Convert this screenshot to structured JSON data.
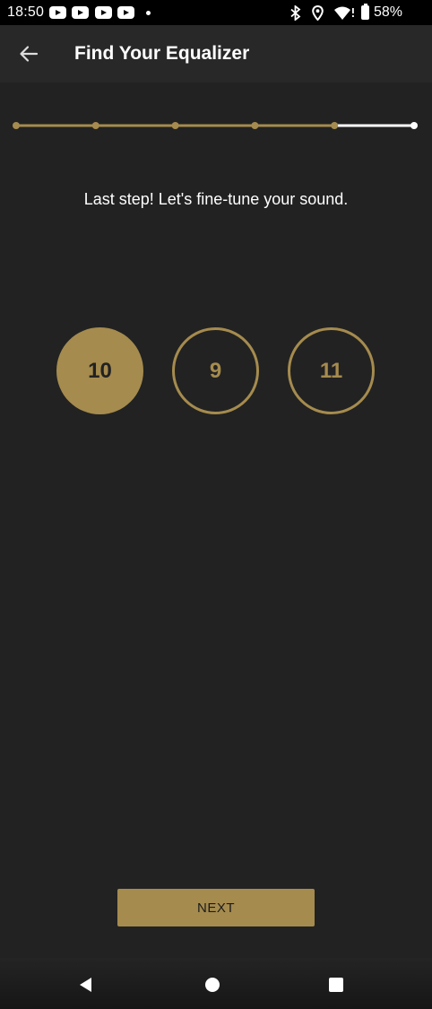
{
  "status_bar": {
    "time": "18:50",
    "battery": "58%",
    "icons": [
      "youtube-icon",
      "youtube-icon",
      "youtube-icon",
      "youtube-icon",
      "dot-icon",
      "bluetooth-icon",
      "location-icon",
      "wifi-icon",
      "battery-icon"
    ]
  },
  "app_bar": {
    "title": "Find Your Equalizer",
    "back_icon": "arrow-left-icon"
  },
  "progress": {
    "total_steps": 6,
    "completed_steps": 5
  },
  "instruction": "Last step! Let's fine-tune your sound.",
  "options": [
    {
      "label": "10",
      "selected": true
    },
    {
      "label": "9",
      "selected": false
    },
    {
      "label": "11",
      "selected": false
    }
  ],
  "next_button": "NEXT",
  "colors": {
    "accent": "#a58b4e",
    "background": "#222222",
    "app_bar": "#282828"
  },
  "nav_bar": {
    "icons": [
      "back-triangle-icon",
      "home-circle-icon",
      "recents-square-icon"
    ]
  }
}
